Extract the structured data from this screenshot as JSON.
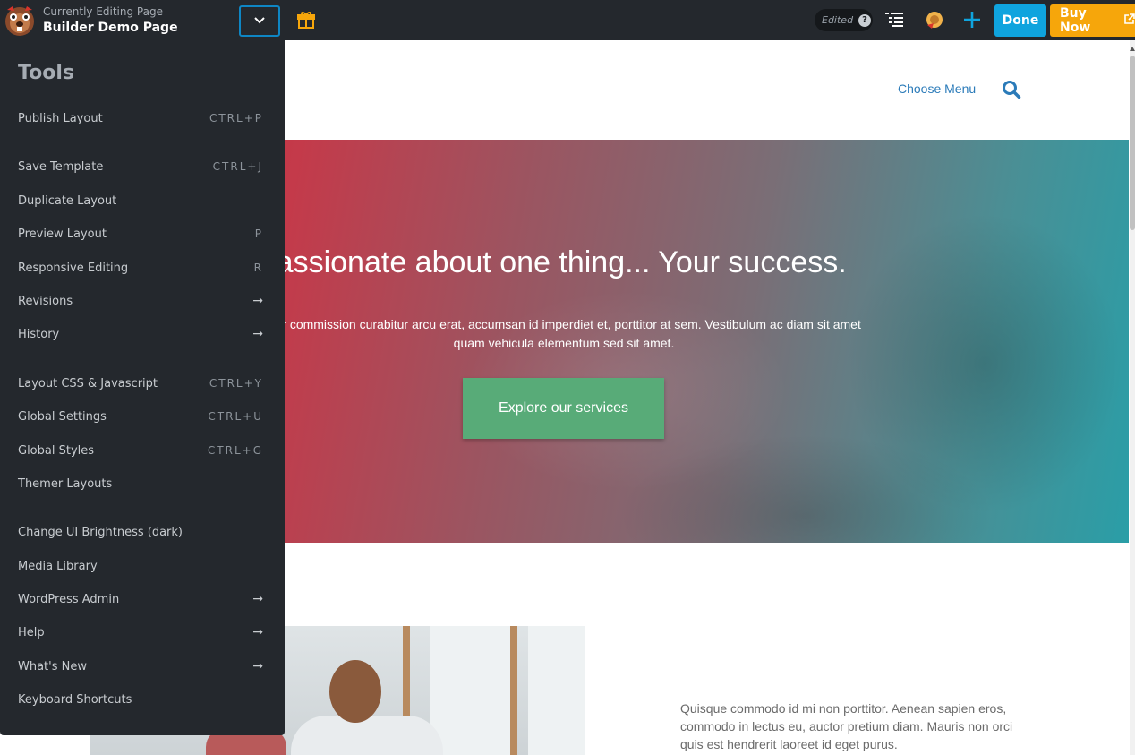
{
  "topbar": {
    "editing_small": "Currently Editing Page",
    "editing_title": "Builder Demo Page",
    "status": "Edited",
    "done_label": "Done",
    "buy_label": "Buy Now"
  },
  "tools": {
    "title": "Tools",
    "items": [
      {
        "label": "Publish Layout",
        "shortcut": "CTRL+P"
      },
      {
        "label": "Save Template",
        "shortcut": "CTRL+J"
      },
      {
        "label": "Duplicate Layout",
        "shortcut": ""
      },
      {
        "label": "Preview Layout",
        "shortcut": "P"
      },
      {
        "label": "Responsive Editing",
        "shortcut": "R"
      },
      {
        "label": "Revisions",
        "shortcut": "→"
      },
      {
        "label": "History",
        "shortcut": "→"
      },
      {
        "label": "Layout CSS & Javascript",
        "shortcut": "CTRL+Y"
      },
      {
        "label": "Global Settings",
        "shortcut": "CTRL+U"
      },
      {
        "label": "Global Styles",
        "shortcut": "CTRL+G"
      },
      {
        "label": "Themer Layouts",
        "shortcut": ""
      },
      {
        "label": "Change UI Brightness (dark)",
        "shortcut": ""
      },
      {
        "label": "Media Library",
        "shortcut": ""
      },
      {
        "label": "WordPress Admin",
        "shortcut": "→"
      },
      {
        "label": "Help",
        "shortcut": "→"
      },
      {
        "label": "What's New",
        "shortcut": "→"
      },
      {
        "label": "Keyboard Shortcuts",
        "shortcut": ""
      }
    ]
  },
  "site": {
    "menu_label": "Choose Menu",
    "hero_title": "Passionate about one thing... Your success.",
    "hero_text": "Per commission curabitur arcu erat, accumsan id imperdiet et, porttitor at sem. Vestibulum ac diam sit amet quam vehicula elementum sed sit amet.",
    "hero_button": "Explore our services",
    "body_text": "Quisque commodo id mi non porttitor. Aenean sapien eros, commodo in lectus eu, auctor pretium diam. Mauris non orci quis est hendrerit laoreet id eget purus."
  },
  "colors": {
    "topbar_bg": "#24282d",
    "done_bg": "#0fa4de",
    "buy_bg": "#f6a60b",
    "hero_button_bg": "#58ab78",
    "link": "#2b7bb9"
  },
  "icons": [
    "beaver-logo-icon",
    "chevron-down-icon",
    "gift-icon",
    "help-icon",
    "outline-icon",
    "notifications-icon",
    "plus-icon",
    "external-link-icon",
    "search-icon"
  ]
}
